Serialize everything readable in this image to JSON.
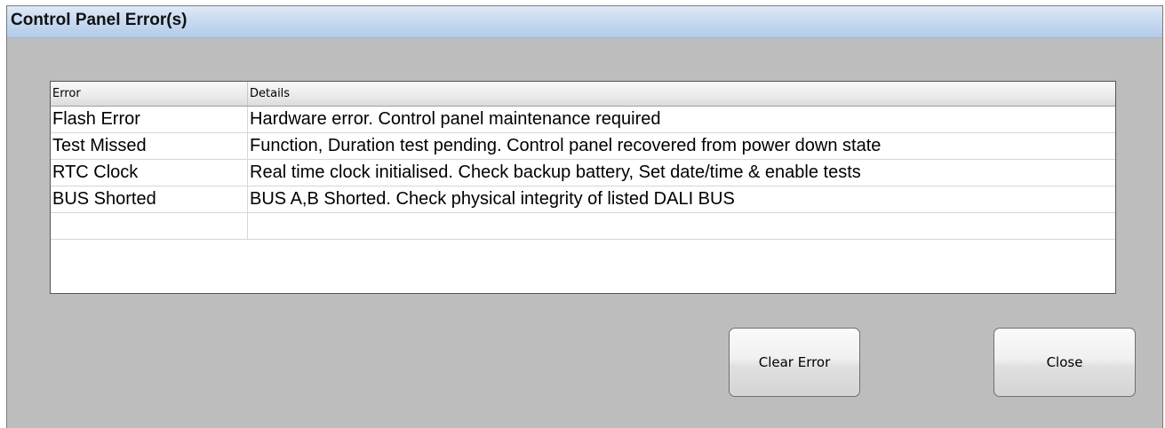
{
  "window": {
    "title": "Control Panel Error(s)"
  },
  "table": {
    "columns": [
      "Error",
      "Details"
    ],
    "rows": [
      {
        "error": "Flash Error",
        "details": "Hardware error. Control panel maintenance required"
      },
      {
        "error": "Test Missed",
        "details": "Function, Duration test pending. Control panel recovered from power down state"
      },
      {
        "error": "RTC Clock",
        "details": "Real time clock initialised. Check backup battery, Set date/time & enable tests"
      },
      {
        "error": "BUS Shorted",
        "details": "BUS A,B Shorted. Check physical integrity of listed DALI BUS"
      },
      {
        "error": "",
        "details": ""
      }
    ]
  },
  "buttons": {
    "clear_label": "Clear Error",
    "close_label": "Close"
  }
}
